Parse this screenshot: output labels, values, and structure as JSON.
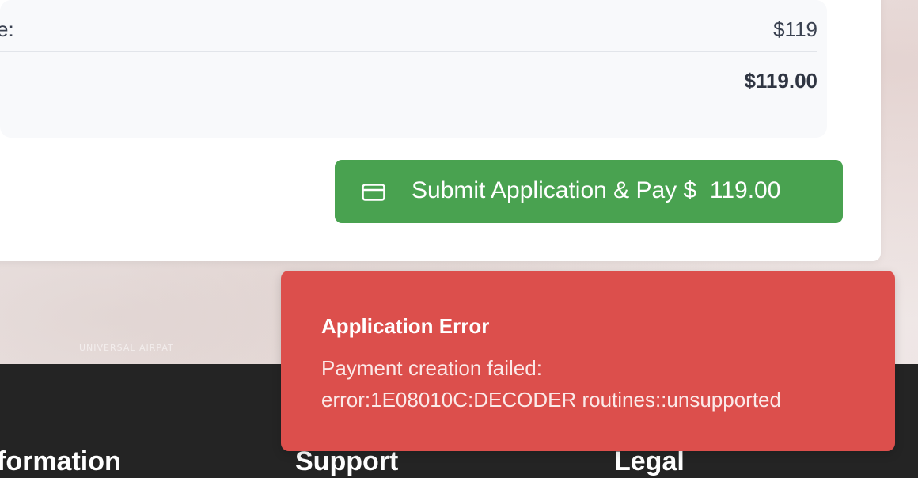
{
  "order_summary": {
    "fee_label": "e:",
    "fee_value": "$119",
    "total_value": "$119.00"
  },
  "submit_button": {
    "label": "Submit Application & Pay $  119.00",
    "icon": "credit-card-icon"
  },
  "background": {
    "caption": "UNIVERSAL AIRPAT"
  },
  "footer": {
    "headings": [
      "formation",
      "Support",
      "Legal"
    ]
  },
  "toast": {
    "title": "Application Error",
    "message_line1": "Payment creation failed:",
    "message_line2": "error:1E08010C:DECODER routines::unsupported"
  },
  "colors": {
    "button_green": "#49a250",
    "toast_red": "#dc4f4c",
    "footer_dark": "#242424"
  }
}
